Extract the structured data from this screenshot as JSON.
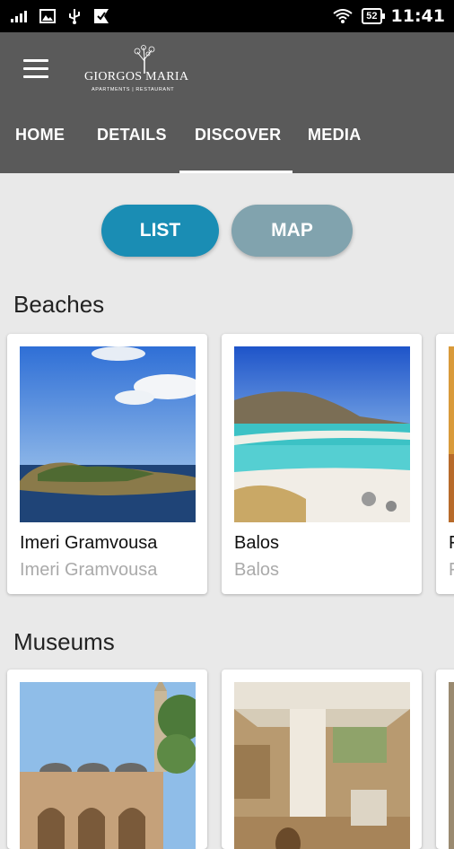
{
  "status_bar": {
    "time": "11:41",
    "battery": "52",
    "icons": [
      "signal-icon",
      "image-icon",
      "usb-icon",
      "check-flag-icon",
      "wifi-icon",
      "battery-icon"
    ]
  },
  "header": {
    "logo_text": "GIORGOS MARIA",
    "logo_subtitle": "APARTMENTS | RESTAURANT",
    "tabs": [
      {
        "label": "HOME"
      },
      {
        "label": "DETAILS"
      },
      {
        "label": "DISCOVER",
        "active": true
      },
      {
        "label": "MEDIA"
      }
    ]
  },
  "view_toggle": {
    "list_label": "LIST",
    "map_label": "MAP",
    "selected": "LIST"
  },
  "sections": [
    {
      "title": "Beaches",
      "cards": [
        {
          "title": "Imeri Gramvousa",
          "subtitle": "Imeri Gramvousa"
        },
        {
          "title": "Balos",
          "subtitle": "Balos"
        },
        {
          "title": "F",
          "subtitle": "F"
        }
      ]
    },
    {
      "title": "Museums",
      "cards": [
        {
          "title": "",
          "subtitle": ""
        },
        {
          "title": "",
          "subtitle": ""
        },
        {
          "title": "",
          "subtitle": ""
        }
      ]
    }
  ],
  "colors": {
    "app_bar": "#5a5a5a",
    "list_button": "#1a8db4",
    "map_button": "#81a3ae",
    "background": "#e9e9e9"
  }
}
